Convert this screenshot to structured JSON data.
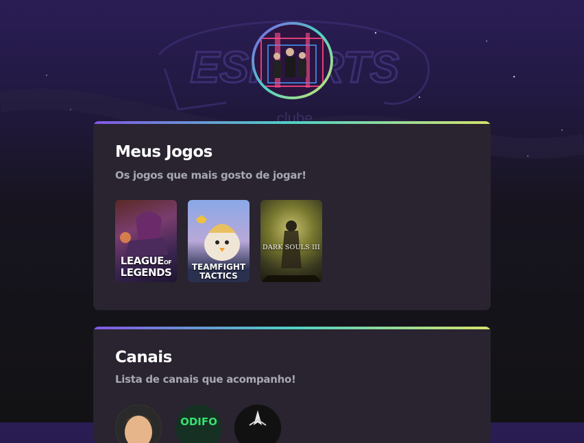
{
  "background": {
    "watermark_text": "ESPORTS",
    "watermark_sub": "clube"
  },
  "avatar": {
    "alt": "Foto de perfil"
  },
  "colors": {
    "accent_gradient": [
      "#8257e5",
      "#4fd1c5",
      "#d6e36b"
    ],
    "card_bg": "#29242f",
    "subtitle": "#a8a8b3"
  },
  "games_section": {
    "title": "Meus Jogos",
    "subtitle": "Os jogos que mais gosto de jogar!",
    "games": [
      {
        "name": "League of Legends",
        "label_line1": "LEAGUE",
        "label_of": "OF",
        "label_line2": "LEGENDS"
      },
      {
        "name": "Teamfight Tactics",
        "label_line1": "TEAMFIGHT",
        "label_line2": "TACTICS"
      },
      {
        "name": "Dark Souls III",
        "label_line1": "DARK SOULS III"
      }
    ]
  },
  "channels_section": {
    "title": "Canais",
    "subtitle": "Lista de canais que acompanho!",
    "channels": [
      {
        "name": "canal-1"
      },
      {
        "name": "canal-2",
        "label": "ODIFO"
      },
      {
        "name": "canal-3"
      }
    ]
  }
}
